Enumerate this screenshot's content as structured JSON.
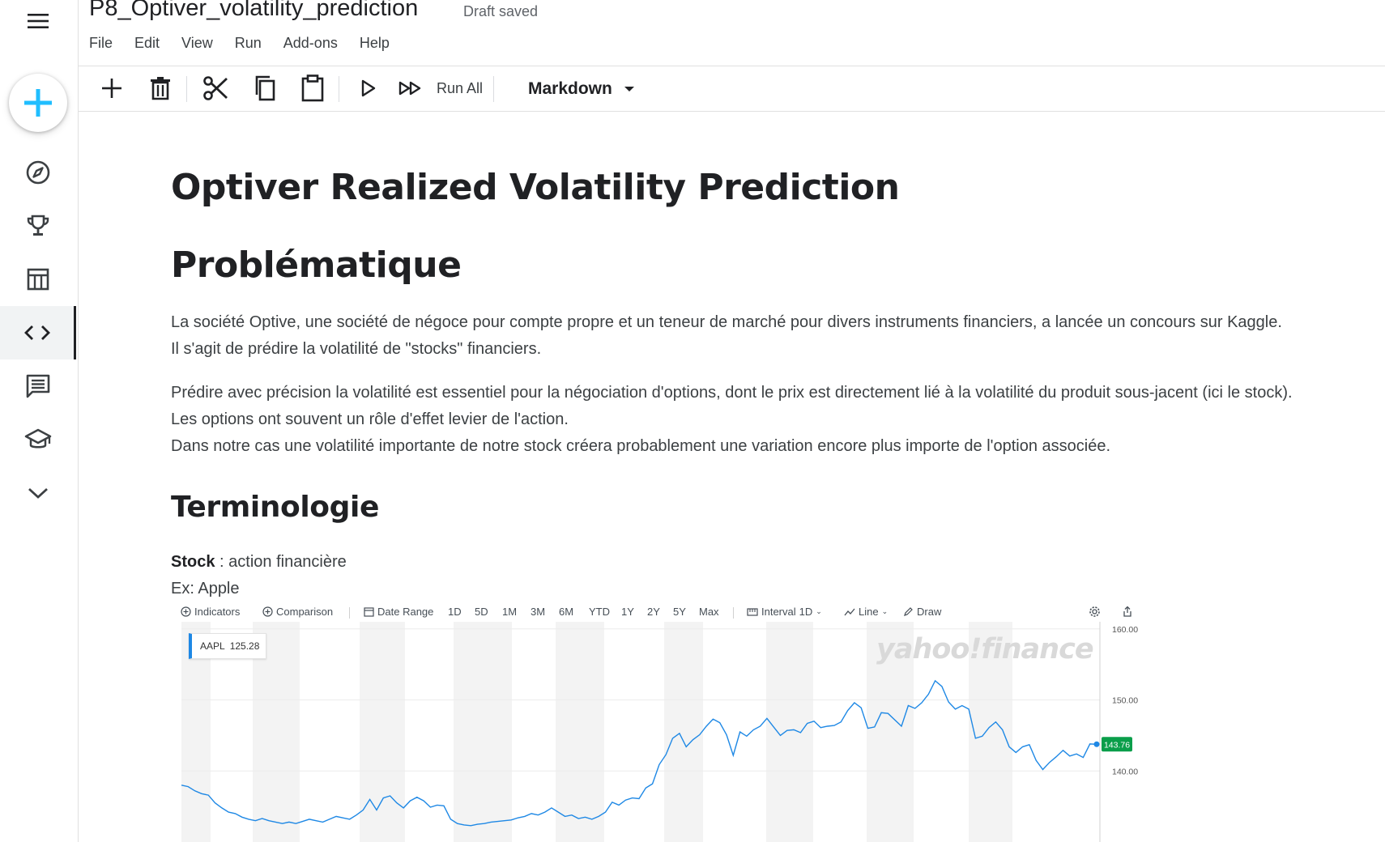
{
  "notebook": {
    "title": "P8_Optiver_volatility_prediction",
    "status": "Draft saved"
  },
  "menu": [
    "File",
    "Edit",
    "View",
    "Run",
    "Add-ons",
    "Help"
  ],
  "sidebar": {
    "items": [
      {
        "icon": "compass-icon",
        "name": "explore"
      },
      {
        "icon": "trophy-icon",
        "name": "competitions"
      },
      {
        "icon": "table-icon",
        "name": "datasets"
      },
      {
        "icon": "code-icon",
        "name": "code",
        "active": true
      },
      {
        "icon": "comment-icon",
        "name": "discussions"
      },
      {
        "icon": "graduation-cap-icon",
        "name": "courses"
      },
      {
        "icon": "chevron-down-icon",
        "name": "more"
      }
    ]
  },
  "toolbar": {
    "run_all_label": "Run All",
    "cell_type": "Markdown"
  },
  "content": {
    "h1": "Optiver Realized Volatility Prediction",
    "h2": "Problématique",
    "p1": [
      "La société Optive, une société de négoce pour compte propre et un teneur de marché pour divers instruments financiers, a lancée un concours sur Kaggle.",
      "Il s'agit de prédire la volatilité de \"stocks\" financiers."
    ],
    "p2": [
      "Prédire avec précision la volatilité est essentiel pour la négociation d'options, dont le prix est directement lié à la volatilité du produit sous-jacent (ici le stock).",
      "Les options ont souvent un rôle d'effet levier de l'action.",
      "Dans notre cas une volatilité importante de notre stock créera probablement une variation encore plus importe de l'option associée."
    ],
    "h3": "Terminologie",
    "term_bold": "Stock",
    "term_rest": " : action financière",
    "example": "Ex: Apple"
  },
  "chart": {
    "toolbar": {
      "indicators": "Indicators",
      "comparison": "Comparison",
      "date_range": "Date Range",
      "ranges": [
        "1D",
        "5D",
        "1M",
        "3M",
        "6M",
        "YTD",
        "1Y",
        "2Y",
        "5Y",
        "Max"
      ],
      "interval_label": "Interval",
      "interval_value": "1D",
      "chart_type": "Line",
      "draw": "Draw"
    },
    "ticker": "AAPL",
    "ticker_value": "125.28",
    "watermark": "yahoo!finance",
    "current_price": "143.76",
    "line_color": "#1e88e5",
    "price_tag_color": "#0a9e4a",
    "y_ticks": [
      "160.00",
      "150.00",
      "140.00"
    ]
  },
  "chart_data": {
    "type": "line",
    "title": "",
    "series": [
      {
        "name": "AAPL",
        "values": [
          138.0,
          137.8,
          137.2,
          136.8,
          136.6,
          135.5,
          134.8,
          134.2,
          134.0,
          133.5,
          133.2,
          133.0,
          133.3,
          133.0,
          132.8,
          132.6,
          132.8,
          132.6,
          132.9,
          133.2,
          133.0,
          132.8,
          133.2,
          133.6,
          133.4,
          133.2,
          133.8,
          134.5,
          136.0,
          134.5,
          136.2,
          136.5,
          135.5,
          134.8,
          135.8,
          136.3,
          135.8,
          134.9,
          135.2,
          135.1,
          133.2,
          132.6,
          132.4,
          132.3,
          132.5,
          132.6,
          132.8,
          132.9,
          133.0,
          133.1,
          133.4,
          133.6,
          134.0,
          133.8,
          134.2,
          134.8,
          134.2,
          133.6,
          133.8,
          133.3,
          133.5,
          133.2,
          133.6,
          134.2,
          135.6,
          135.2,
          135.9,
          136.2,
          136.1,
          137.6,
          138.2,
          140.9,
          142.3,
          144.6,
          145.3,
          143.4,
          144.4,
          145.1,
          146.3,
          147.3,
          146.8,
          145.1,
          142.2,
          145.5,
          144.9,
          145.8,
          146.3,
          147.4,
          146.2,
          145.0,
          145.7,
          145.8,
          145.4,
          146.7,
          147.0,
          146.1,
          146.3,
          146.4,
          146.9,
          148.5,
          149.6,
          148.9,
          146.0,
          146.2,
          148.2,
          148.1,
          147.2,
          146.3,
          149.2,
          148.8,
          149.6,
          150.8,
          152.7,
          151.9,
          149.7,
          148.7,
          149.2,
          148.7,
          144.6,
          144.9,
          146.1,
          146.9,
          145.8,
          143.4,
          142.6,
          143.4,
          143.7,
          141.5,
          140.2,
          141.2,
          142.0,
          142.9,
          142.1,
          142.4,
          141.9,
          143.8,
          143.76
        ]
      }
    ],
    "ylim": [
      130,
      161
    ],
    "y_ticks": [
      160,
      150,
      140
    ],
    "grid": true
  }
}
